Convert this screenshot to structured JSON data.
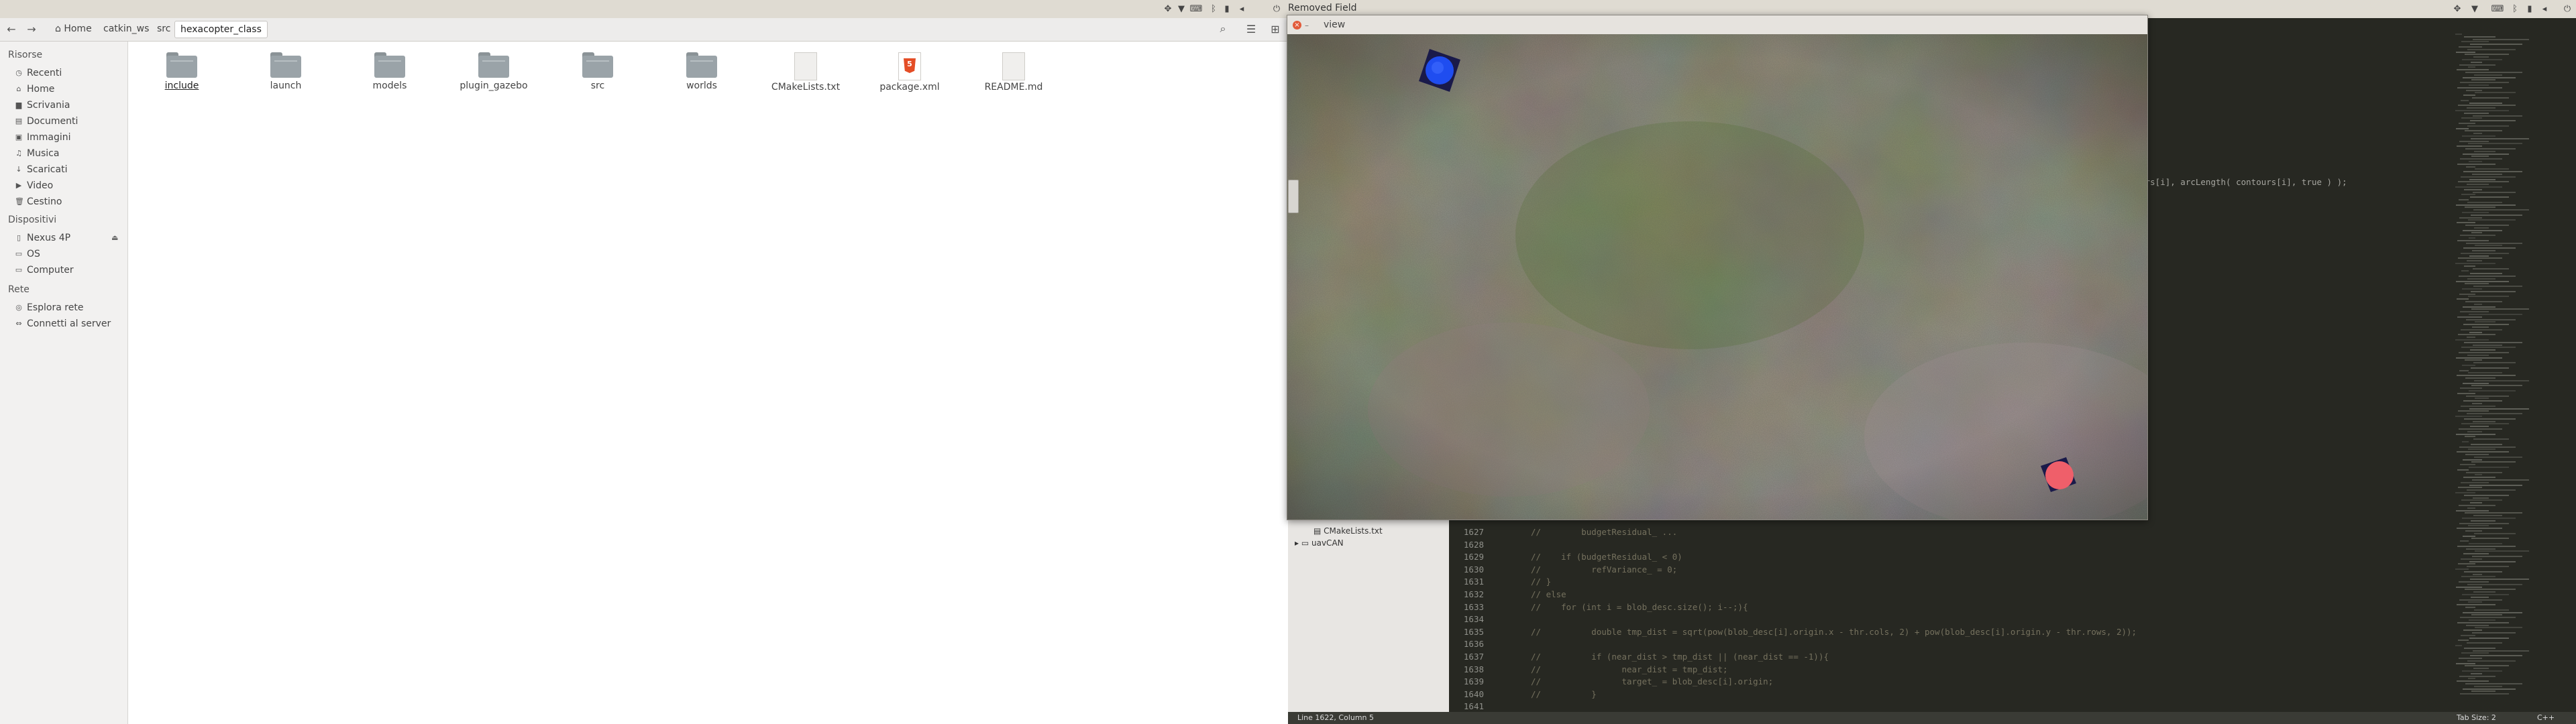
{
  "file_manager": {
    "breadcrumbs": [
      "Home",
      "catkin_ws",
      "src",
      "hexacopter_class"
    ],
    "sidebar": {
      "sections": [
        {
          "title": "Risorse",
          "items": [
            {
              "label": "Recenti",
              "icon": "clock-icon"
            },
            {
              "label": "Home",
              "icon": "home-icon"
            },
            {
              "label": "Scrivania",
              "icon": "desktop-icon"
            },
            {
              "label": "Documenti",
              "icon": "documents-icon"
            },
            {
              "label": "Immagini",
              "icon": "images-icon"
            },
            {
              "label": "Musica",
              "icon": "music-icon"
            },
            {
              "label": "Scaricati",
              "icon": "download-icon"
            },
            {
              "label": "Video",
              "icon": "video-icon"
            },
            {
              "label": "Cestino",
              "icon": "trash-icon"
            }
          ]
        },
        {
          "title": "Dispositivi",
          "items": [
            {
              "label": "Nexus 4P",
              "icon": "phone-icon"
            },
            {
              "label": "OS",
              "icon": "drive-icon"
            },
            {
              "label": "Computer",
              "icon": "computer-icon"
            }
          ]
        },
        {
          "title": "Rete",
          "items": [
            {
              "label": "Esplora rete",
              "icon": "network-icon"
            },
            {
              "label": "Connetti al server",
              "icon": "server-icon"
            }
          ]
        }
      ]
    },
    "files": [
      {
        "name": "include",
        "type": "folder",
        "selected": true
      },
      {
        "name": "launch",
        "type": "folder"
      },
      {
        "name": "models",
        "type": "folder"
      },
      {
        "name": "plugin_gazebo",
        "type": "folder"
      },
      {
        "name": "src",
        "type": "folder"
      },
      {
        "name": "worlds",
        "type": "folder"
      },
      {
        "name": "CMakeLists.txt",
        "type": "text"
      },
      {
        "name": "package.xml",
        "type": "html5"
      },
      {
        "name": "README.md",
        "type": "text"
      }
    ]
  },
  "top_panel": {
    "window_title": "Removed Field"
  },
  "view_window": {
    "title": "view"
  },
  "editor": {
    "tree": [
      {
        "label": "CMakeLists.txt",
        "indent": 1
      },
      {
        "label": "uavCAN",
        "indent": 0
      }
    ],
    "code_lines": [
      {
        "n": "1627",
        "text": "//        budgetResidual_ ..."
      },
      {
        "n": "1628",
        "text": ""
      },
      {
        "n": "1629",
        "text": "//    if (budgetResidual_ < 0)"
      },
      {
        "n": "1630",
        "text": "//          refVariance_ = 0;"
      },
      {
        "n": "1631",
        "text": "// }"
      },
      {
        "n": "1632",
        "text": "// else"
      },
      {
        "n": "1633",
        "text": "//    for (int i = blob_desc.size(); i--;){"
      },
      {
        "n": "1634",
        "text": ""
      },
      {
        "n": "1635",
        "text": "//          double tmp_dist = sqrt(pow(blob_desc[i].origin.x - thr.cols, 2) + pow(blob_desc[i].origin.y - thr.rows, 2));"
      },
      {
        "n": "1636",
        "text": ""
      },
      {
        "n": "1637",
        "text": "//          if (near_dist > tmp_dist || (near_dist == -1)){"
      },
      {
        "n": "1638",
        "text": "//                near_dist = tmp_dist;"
      },
      {
        "n": "1639",
        "text": "//                target_ = blob_desc[i].origin;"
      },
      {
        "n": "1640",
        "text": "//          }"
      },
      {
        "n": "1641",
        "text": ""
      }
    ],
    "stray_code": "ontours[i], arcLength( contours[i], true ) );",
    "status_left": "Line 1622, Column 5",
    "status_tab": "Tab Size: 2",
    "status_lang": "C++"
  },
  "colors": {
    "blue_marker": "#1f4df0",
    "red_marker": "#ef5f6a",
    "marker_frame": "#1a1a4a"
  }
}
